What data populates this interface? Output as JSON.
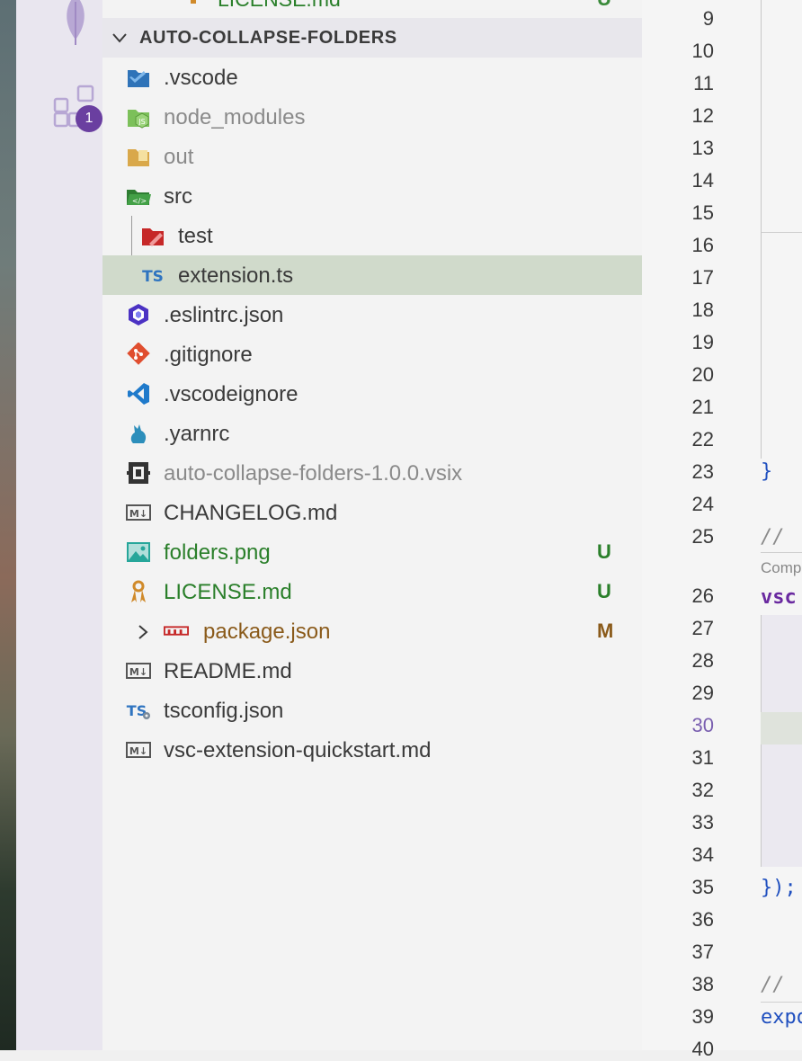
{
  "activity_bar": {
    "extensions_badge": "1"
  },
  "previous_row": {
    "label": "LICENSE.md",
    "status": "U"
  },
  "explorer": {
    "section_title": "AUTO-COLLAPSE-FOLDERS",
    "items": [
      {
        "label": ".vscode"
      },
      {
        "label": "node_modules"
      },
      {
        "label": "out"
      },
      {
        "label": "src"
      },
      {
        "label": "test"
      },
      {
        "label": "extension.ts"
      },
      {
        "label": ".eslintrc.json"
      },
      {
        "label": ".gitignore"
      },
      {
        "label": ".vscodeignore"
      },
      {
        "label": ".yarnrc"
      },
      {
        "label": "auto-collapse-folders-1.0.0.vsix"
      },
      {
        "label": "CHANGELOG.md"
      },
      {
        "label": "folders.png",
        "status": "U"
      },
      {
        "label": "LICENSE.md",
        "status": "U"
      },
      {
        "label": "package.json",
        "status": "M"
      },
      {
        "label": "README.md"
      },
      {
        "label": "tsconfig.json"
      },
      {
        "label": "vsc-extension-quickstart.md"
      }
    ]
  },
  "editor": {
    "line_numbers": [
      "9",
      "10",
      "11",
      "12",
      "13",
      "14",
      "15",
      "16",
      "17",
      "18",
      "19",
      "20",
      "21",
      "22",
      "23",
      "24",
      "25",
      "26",
      "27",
      "28",
      "29",
      "30",
      "31",
      "32",
      "33",
      "34",
      "35",
      "36",
      "37",
      "38",
      "39",
      "40"
    ],
    "active_line": "30",
    "code_fragments": {
      "brace": "}",
      "comment1": "// ",
      "codelens": "Comp",
      "vsc": "vsc",
      "close": "});",
      "comment2": "//",
      "expo": "expo"
    }
  },
  "colors": {
    "selected_row": "#d0dacb",
    "untracked": "#2a7f2a",
    "modified": "#8a5a1a",
    "badge": "#6a3fa0"
  }
}
